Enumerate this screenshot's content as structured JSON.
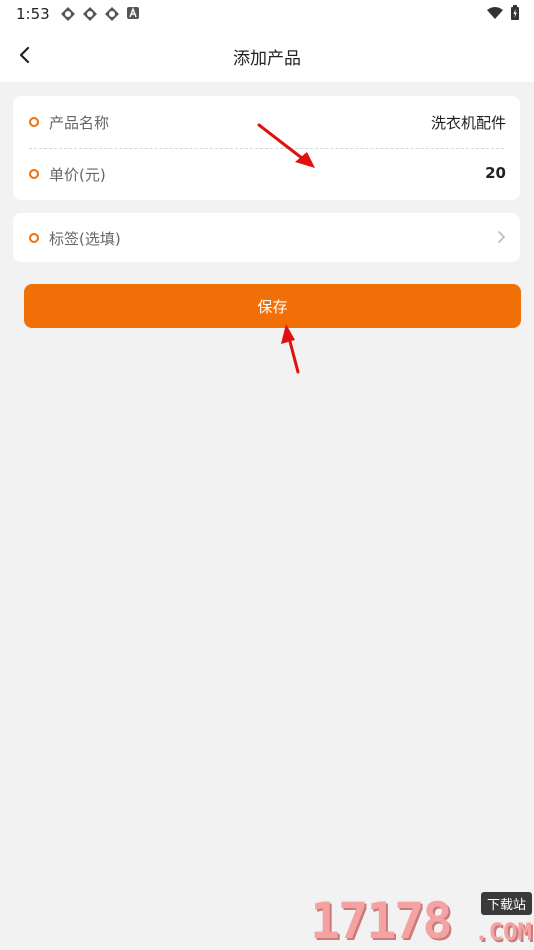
{
  "status_bar": {
    "time": "1:53",
    "icons": [
      "notification-icon",
      "notification-icon",
      "notification-icon",
      "a-badge-icon"
    ],
    "right_icons": [
      "wifi-icon",
      "battery-icon"
    ]
  },
  "header": {
    "title": "添加产品",
    "back_icon": "chevron-left-icon"
  },
  "form": {
    "name_label": "产品名称",
    "name_value": "洗衣机配件",
    "price_label": "单价(元)",
    "price_value": "20",
    "tag_label": "标签(选填)",
    "tag_icon": "chevron-right-icon"
  },
  "save_label": "保存",
  "watermark": {
    "digits": "17178",
    "tag": "下载站",
    "domain": ".COM"
  },
  "colors": {
    "accent": "#f07007",
    "background": "#f2f2f2",
    "card": "#ffffff",
    "annotation_arrow": "#e01010"
  }
}
